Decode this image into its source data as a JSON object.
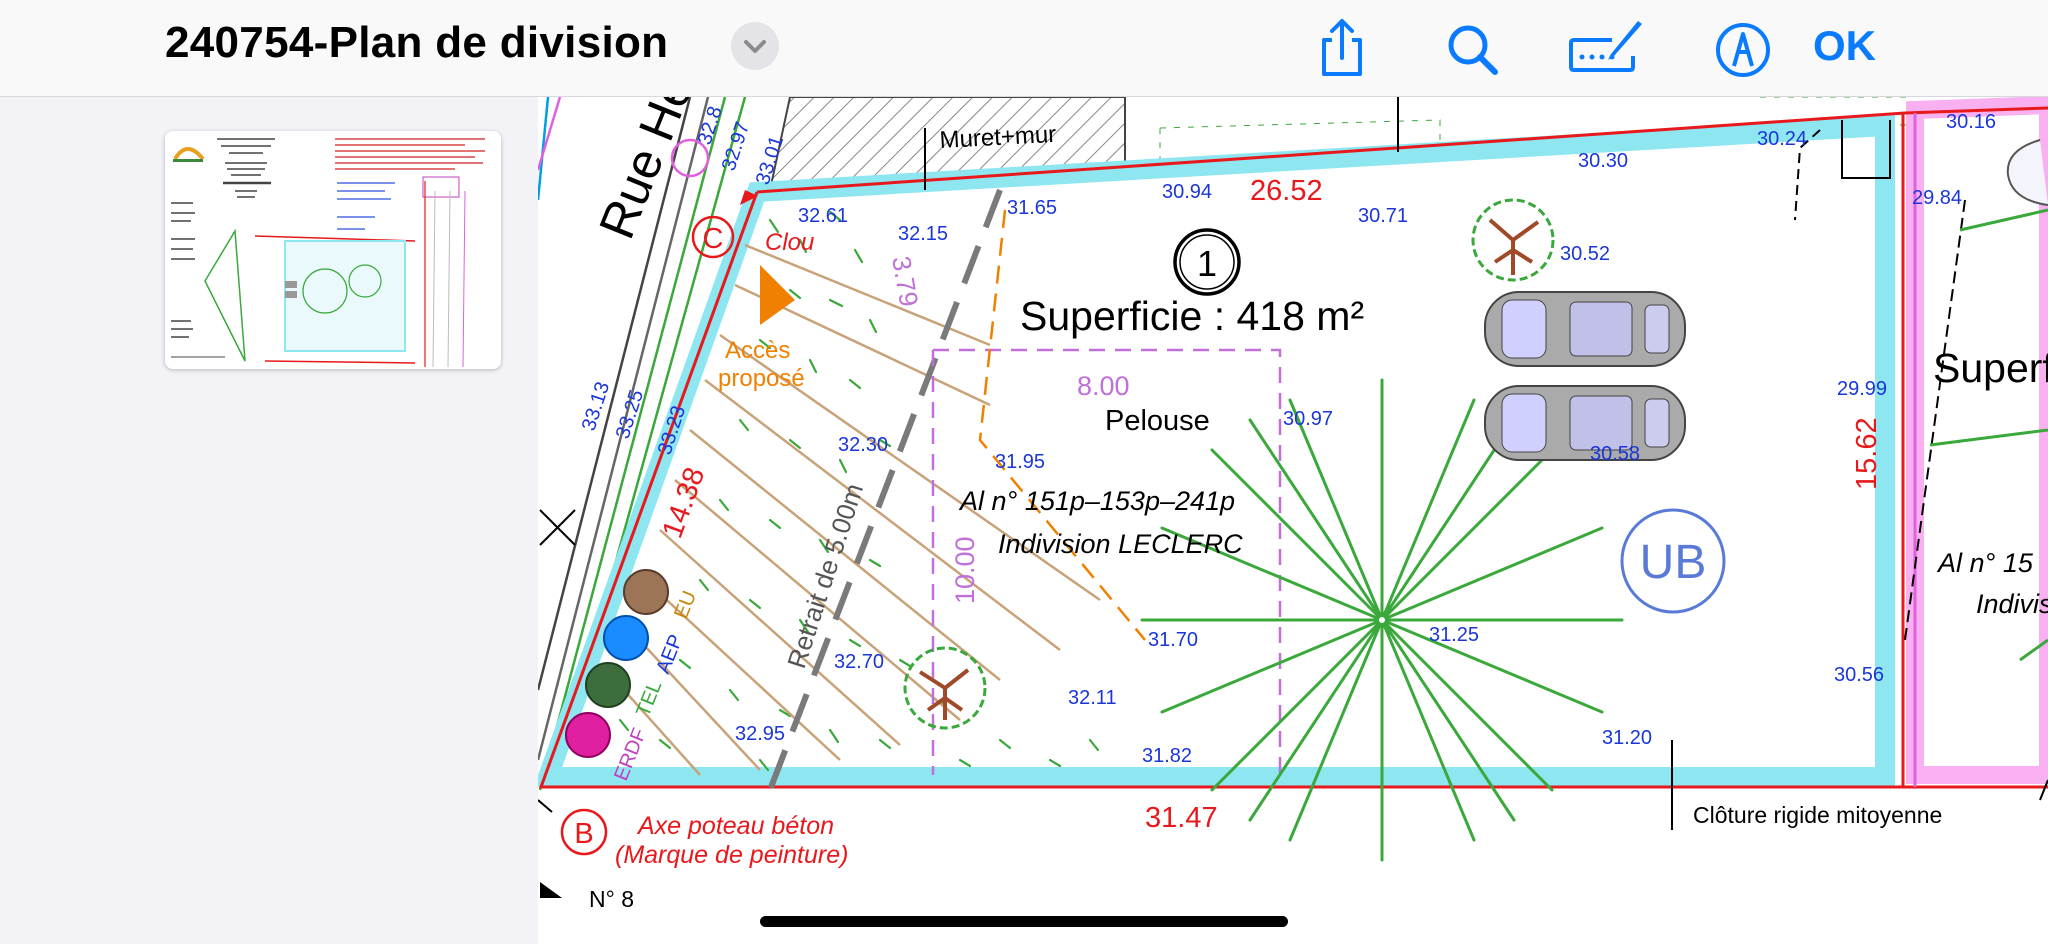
{
  "header": {
    "title": "240754-Plan de division",
    "ok_label": "OK",
    "icons": [
      "share-icon",
      "search-icon",
      "annotate-icon",
      "markup-icon",
      "chevron-down-icon"
    ]
  },
  "colors": {
    "accent": "#0a7aff",
    "dimension_red": "#e8191c",
    "elevation_blue": "#1a36d8",
    "cadastral_magenta": "#c040c0",
    "lawn_green": "#3aa83a",
    "access_orange": "#f08000",
    "zone_blue": "#5a7ad8"
  },
  "plan": {
    "street": "Rue Henri",
    "wall_label": "Muret+mur",
    "lot_number": "1",
    "area_label": "Superficie : 418 m²",
    "lawn_label": "Pelouse",
    "parcel_ref": "Al n° 151p–153p–241p",
    "owner": "Indivision LECLERC",
    "zone": "UB",
    "setback": "Retrait de 5.00m",
    "access": [
      "Accès",
      "proposé"
    ],
    "nail": "Clou",
    "point_c": "C",
    "point_b": "B",
    "pole_note": [
      "Axe poteau béton",
      "(Marque de peinture)"
    ],
    "fence": "Clôture rigide mitoyenne",
    "house_no": "N° 8",
    "neighbor_area": "Superf",
    "neighbor_ref": "Al n° 15",
    "neighbor_owner": "Indivis",
    "networks": [
      "EU",
      "AEP",
      "TEL",
      "ERDF"
    ],
    "dimensions_red": [
      "26.52",
      "14.38",
      "31.47",
      "15.62"
    ],
    "dimensions_purple": [
      "8.00",
      "10.00",
      "3.79"
    ],
    "elevations": [
      "33.13",
      "33.25",
      "33.23",
      "32.8",
      "32.97",
      "33.01",
      "32.61",
      "32.15",
      "31.65",
      "30.94",
      "30.71",
      "30.30",
      "30.24",
      "30.16",
      "29.84",
      "30.52",
      "29.99",
      "30.58",
      "30.97",
      "31.95",
      "32.30",
      "31.70",
      "31.25",
      "32.70",
      "32.11",
      "32.95",
      "31.82",
      "31.20",
      "30.56"
    ]
  }
}
